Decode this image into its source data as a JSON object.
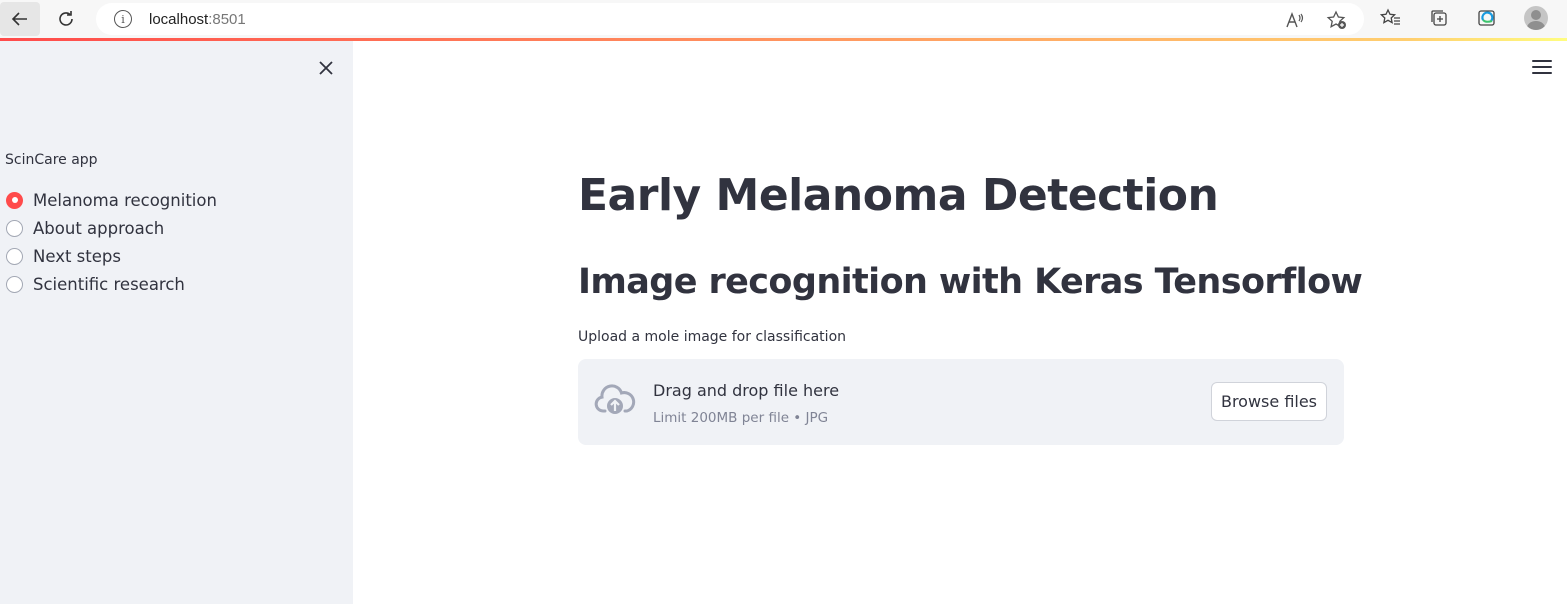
{
  "browser": {
    "url_host": "localhost",
    "url_port": ":8501"
  },
  "sidebar": {
    "label": "ScinCare app",
    "options": [
      {
        "label": "Melanoma recognition",
        "selected": true
      },
      {
        "label": "About approach",
        "selected": false
      },
      {
        "label": "Next steps",
        "selected": false
      },
      {
        "label": "Scientific research",
        "selected": false
      }
    ]
  },
  "main": {
    "title": "Early Melanoma Detection",
    "subtitle": "Image recognition with Keras Tensorflow",
    "uploader": {
      "label": "Upload a mole image for classification",
      "drop_text": "Drag and drop file here",
      "limit_text": "Limit 200MB per file • JPG",
      "button_label": "Browse files"
    }
  },
  "colors": {
    "accent": "#ff4b4b",
    "sidebar_bg": "#f0f2f6",
    "text": "#31333f"
  },
  "icons": {
    "back": "arrow-left-icon",
    "refresh": "refresh-icon",
    "info": "info-icon",
    "read_aloud": "read-aloud-icon",
    "add_favorite": "star-add-icon",
    "favorites": "favorites-icon",
    "collections": "collections-icon",
    "edge": "edge-icon",
    "profile": "profile-icon",
    "close": "close-icon",
    "menu": "hamburger-menu-icon",
    "upload": "cloud-upload-icon"
  }
}
